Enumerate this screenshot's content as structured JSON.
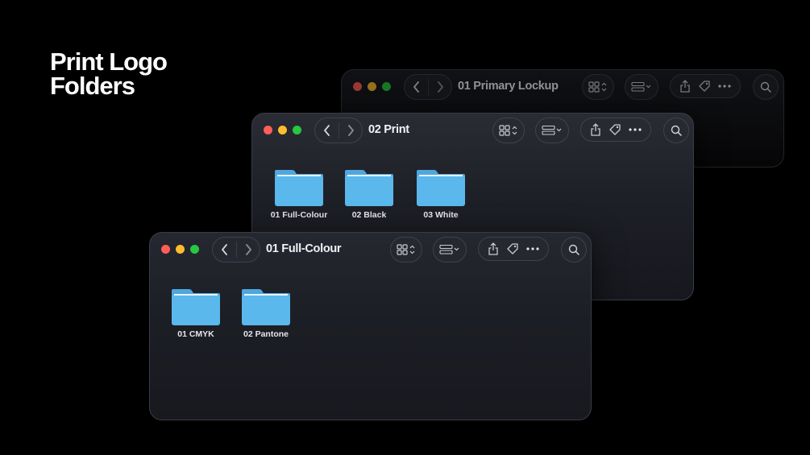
{
  "heading": {
    "line1": "Print Logo",
    "line2": "Folders"
  },
  "windows": {
    "back": {
      "title": "01 Primary Lockup"
    },
    "middle": {
      "title": "02 Print",
      "folders": [
        {
          "label": "01 Full-Colour"
        },
        {
          "label": "02 Black"
        },
        {
          "label": "03 White"
        }
      ]
    },
    "front": {
      "title": "01 Full-Colour",
      "folders": [
        {
          "label": "01 CMYK"
        },
        {
          "label": "02 Pantone"
        }
      ]
    }
  },
  "colors": {
    "close": "#ff5f57",
    "minimize": "#febc2e",
    "zoom": "#28c840",
    "folder": "#5ab8ec",
    "background": "#000000"
  },
  "icons": [
    "chevron-left-icon",
    "chevron-right-icon",
    "grid-view-icon",
    "group-icon",
    "share-icon",
    "tag-icon",
    "more-icon",
    "search-icon",
    "folder-icon"
  ]
}
